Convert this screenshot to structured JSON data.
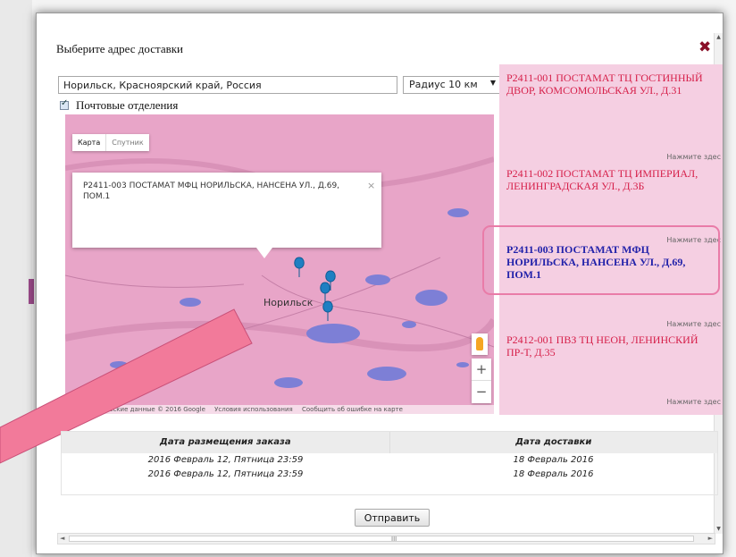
{
  "dialog": {
    "title": "Выберите адрес доставки",
    "close_glyph": "✖"
  },
  "search": {
    "address_value": "Норильск, Красноярский край, Россия",
    "radius_value": "Радиус 10 км",
    "postal_label": "Почтовые отделения",
    "postal_checked": true
  },
  "map": {
    "type_map": "Карта",
    "type_satellite": "Спутник",
    "popup_text": "P2411-003 ПОСТАМАТ МФЦ НОРИЛЬСКА, НАНСЕНА УЛ., Д.69, ПОМ.1",
    "popup_close": "×",
    "city_label": "Норильск",
    "zoom_in": "+",
    "zoom_out": "−",
    "attribution_data": "Картографические данные © 2016 Google",
    "attribution_terms": "Условия использования",
    "attribution_report": "Сообщить об ошибке на карте"
  },
  "list": {
    "items": [
      {
        "name": "P2411-001 ПОСТАМАТ ТЦ ГОСТИННЫЙ ДВОР, КОМСОМОЛЬСКАЯ УЛ., Д.31",
        "more": "Нажмите здес"
      },
      {
        "name": "P2411-002 ПОСТАМАТ ТЦ ИМПЕРИАЛ, ЛЕНИНГРАДСКАЯ УЛ., Д.3Б",
        "more": "Нажмите здес"
      },
      {
        "name": "P2411-003 ПОСТАМАТ МФЦ НОРИЛЬСКА, НАНСЕНА УЛ., Д.69, ПОМ.1",
        "more": "Нажмите здес"
      },
      {
        "name": "P2412-001 ПВЗ ТЦ НЕОН, ЛЕНИНСКИЙ ПР-Т, Д.35",
        "more": "Нажмите здес"
      }
    ]
  },
  "table": {
    "headers": [
      "Дата размещения заказа",
      "Дата доставки"
    ],
    "rows": [
      [
        "2016 Февраль 12, Пятница 23:59",
        "18 Февраль 2016"
      ],
      [
        "2016 Февраль 12, Пятница 23:59",
        "18 Февраль 2016"
      ]
    ]
  },
  "submit_label": "Отправить",
  "scrollbar": {
    "grip": "III"
  },
  "colors": {
    "accent_red": "#d6204a",
    "selected_blue": "#2222aa",
    "list_bg": "#f5cfe2",
    "map_bg": "#e8a5c8",
    "marker_blue": "#1e7fc2",
    "highlight_pink": "#e97ca8"
  }
}
